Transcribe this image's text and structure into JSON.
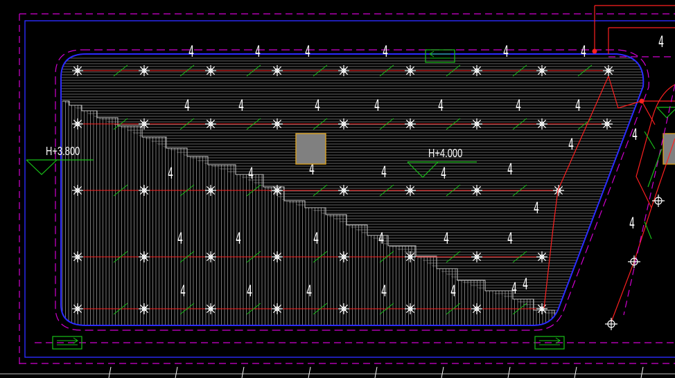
{
  "drawing": {
    "elevations": [
      {
        "id": "left",
        "text": "H+3.800"
      },
      {
        "id": "mid",
        "text": "H+4.000"
      }
    ],
    "sprinkler_code": "4",
    "colors": {
      "background": "#000000",
      "hatch": "#c8c8c8",
      "outline_blue": "#2b2bff",
      "boundary_magenta": "#d100d1",
      "pipe_red": "#ff2020",
      "marker_green": "#18c018",
      "column_fill": "#808080",
      "column_border": "#d8a020",
      "symbol_white": "#ffffff"
    },
    "icons": [
      "sprinkler-head-icon",
      "column-icon",
      "elevation-marker-icon",
      "flow-arrow-icon"
    ]
  }
}
